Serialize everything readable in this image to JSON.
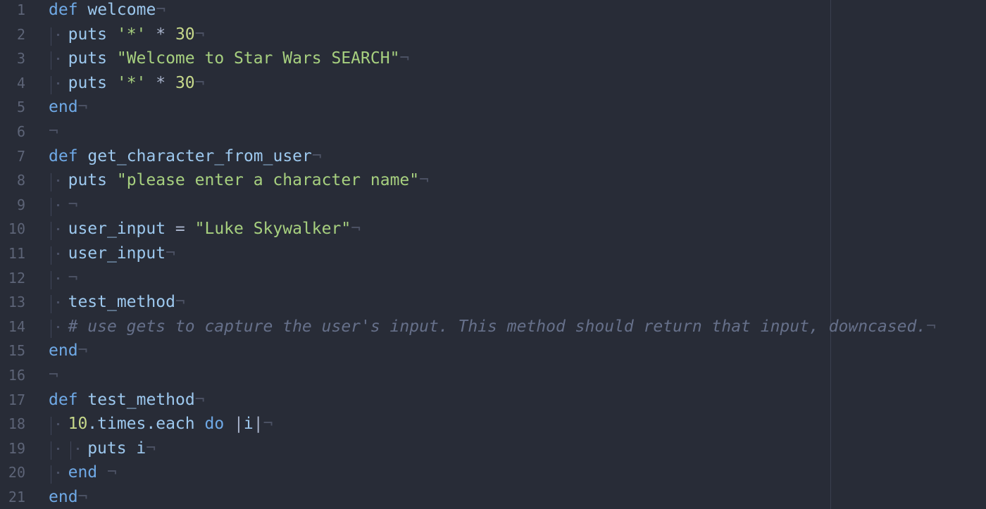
{
  "editor": {
    "lines": [
      {
        "num": "1",
        "indent": 0,
        "tokens": [
          {
            "t": "def",
            "c": "kw"
          },
          {
            "t": " welcome",
            "c": "fn"
          }
        ]
      },
      {
        "num": "2",
        "indent": 1,
        "tokens": [
          {
            "t": "puts",
            "c": "fn"
          },
          {
            "t": " ",
            "c": "plain"
          },
          {
            "t": "'*'",
            "c": "str"
          },
          {
            "t": " * ",
            "c": "op"
          },
          {
            "t": "30",
            "c": "num"
          }
        ]
      },
      {
        "num": "3",
        "indent": 1,
        "tokens": [
          {
            "t": "puts",
            "c": "fn"
          },
          {
            "t": " ",
            "c": "plain"
          },
          {
            "t": "\"Welcome to Star Wars SEARCH\"",
            "c": "str"
          }
        ]
      },
      {
        "num": "4",
        "indent": 1,
        "tokens": [
          {
            "t": "puts",
            "c": "fn"
          },
          {
            "t": " ",
            "c": "plain"
          },
          {
            "t": "'*'",
            "c": "str"
          },
          {
            "t": " * ",
            "c": "op"
          },
          {
            "t": "30",
            "c": "num"
          }
        ]
      },
      {
        "num": "5",
        "indent": 0,
        "tokens": [
          {
            "t": "end",
            "c": "kw"
          }
        ]
      },
      {
        "num": "6",
        "indent": 0,
        "tokens": []
      },
      {
        "num": "7",
        "indent": 0,
        "tokens": [
          {
            "t": "def",
            "c": "kw"
          },
          {
            "t": " get_character_from_user",
            "c": "fn"
          }
        ]
      },
      {
        "num": "8",
        "indent": 1,
        "tokens": [
          {
            "t": "puts",
            "c": "fn"
          },
          {
            "t": " ",
            "c": "plain"
          },
          {
            "t": "\"please enter a character name\"",
            "c": "str"
          }
        ]
      },
      {
        "num": "9",
        "indent": 1,
        "tokens": []
      },
      {
        "num": "10",
        "indent": 1,
        "tokens": [
          {
            "t": "user_input",
            "c": "fn"
          },
          {
            "t": " = ",
            "c": "op"
          },
          {
            "t": "\"Luke Skywalker\"",
            "c": "str"
          }
        ]
      },
      {
        "num": "11",
        "indent": 1,
        "tokens": [
          {
            "t": "user_input",
            "c": "fn"
          }
        ]
      },
      {
        "num": "12",
        "indent": 1,
        "tokens": []
      },
      {
        "num": "13",
        "indent": 1,
        "tokens": [
          {
            "t": "test_method",
            "c": "fn"
          }
        ]
      },
      {
        "num": "14",
        "indent": 1,
        "tokens": [
          {
            "t": "# use gets to capture the user's input. This method should return that input, downcased.",
            "c": "comment"
          }
        ]
      },
      {
        "num": "15",
        "indent": 0,
        "tokens": [
          {
            "t": "end",
            "c": "kw"
          }
        ]
      },
      {
        "num": "16",
        "indent": 0,
        "tokens": []
      },
      {
        "num": "17",
        "indent": 0,
        "tokens": [
          {
            "t": "def",
            "c": "kw"
          },
          {
            "t": " test_method",
            "c": "fn"
          }
        ]
      },
      {
        "num": "18",
        "indent": 1,
        "tokens": [
          {
            "t": "10",
            "c": "num"
          },
          {
            "t": ".times.each",
            "c": "fn"
          },
          {
            "t": " ",
            "c": "plain"
          },
          {
            "t": "do",
            "c": "kw"
          },
          {
            "t": " |",
            "c": "op"
          },
          {
            "t": "i",
            "c": "fn"
          },
          {
            "t": "|",
            "c": "op"
          }
        ]
      },
      {
        "num": "19",
        "indent": 2,
        "tokens": [
          {
            "t": "puts",
            "c": "fn"
          },
          {
            "t": " i",
            "c": "fn"
          }
        ]
      },
      {
        "num": "20",
        "indent": 1,
        "tokens": [
          {
            "t": "end",
            "c": "kw"
          },
          {
            "t": " ",
            "c": "plain"
          }
        ]
      },
      {
        "num": "21",
        "indent": 0,
        "tokens": [
          {
            "t": "end",
            "c": "kw"
          }
        ]
      }
    ],
    "eol_marker": "¬",
    "indent_marker": "·"
  }
}
